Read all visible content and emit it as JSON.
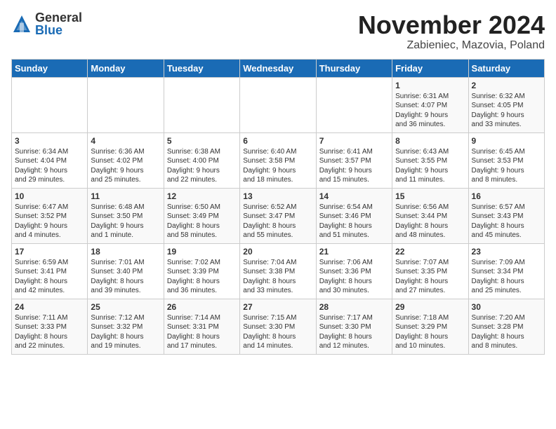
{
  "logo": {
    "general": "General",
    "blue": "Blue"
  },
  "header": {
    "month": "November 2024",
    "location": "Zabieniec, Mazovia, Poland"
  },
  "weekdays": [
    "Sunday",
    "Monday",
    "Tuesday",
    "Wednesday",
    "Thursday",
    "Friday",
    "Saturday"
  ],
  "weeks": [
    [
      {
        "day": "",
        "info": ""
      },
      {
        "day": "",
        "info": ""
      },
      {
        "day": "",
        "info": ""
      },
      {
        "day": "",
        "info": ""
      },
      {
        "day": "",
        "info": ""
      },
      {
        "day": "1",
        "info": "Sunrise: 6:31 AM\nSunset: 4:07 PM\nDaylight: 9 hours\nand 36 minutes."
      },
      {
        "day": "2",
        "info": "Sunrise: 6:32 AM\nSunset: 4:05 PM\nDaylight: 9 hours\nand 33 minutes."
      }
    ],
    [
      {
        "day": "3",
        "info": "Sunrise: 6:34 AM\nSunset: 4:04 PM\nDaylight: 9 hours\nand 29 minutes."
      },
      {
        "day": "4",
        "info": "Sunrise: 6:36 AM\nSunset: 4:02 PM\nDaylight: 9 hours\nand 25 minutes."
      },
      {
        "day": "5",
        "info": "Sunrise: 6:38 AM\nSunset: 4:00 PM\nDaylight: 9 hours\nand 22 minutes."
      },
      {
        "day": "6",
        "info": "Sunrise: 6:40 AM\nSunset: 3:58 PM\nDaylight: 9 hours\nand 18 minutes."
      },
      {
        "day": "7",
        "info": "Sunrise: 6:41 AM\nSunset: 3:57 PM\nDaylight: 9 hours\nand 15 minutes."
      },
      {
        "day": "8",
        "info": "Sunrise: 6:43 AM\nSunset: 3:55 PM\nDaylight: 9 hours\nand 11 minutes."
      },
      {
        "day": "9",
        "info": "Sunrise: 6:45 AM\nSunset: 3:53 PM\nDaylight: 9 hours\nand 8 minutes."
      }
    ],
    [
      {
        "day": "10",
        "info": "Sunrise: 6:47 AM\nSunset: 3:52 PM\nDaylight: 9 hours\nand 4 minutes."
      },
      {
        "day": "11",
        "info": "Sunrise: 6:48 AM\nSunset: 3:50 PM\nDaylight: 9 hours\nand 1 minute."
      },
      {
        "day": "12",
        "info": "Sunrise: 6:50 AM\nSunset: 3:49 PM\nDaylight: 8 hours\nand 58 minutes."
      },
      {
        "day": "13",
        "info": "Sunrise: 6:52 AM\nSunset: 3:47 PM\nDaylight: 8 hours\nand 55 minutes."
      },
      {
        "day": "14",
        "info": "Sunrise: 6:54 AM\nSunset: 3:46 PM\nDaylight: 8 hours\nand 51 minutes."
      },
      {
        "day": "15",
        "info": "Sunrise: 6:56 AM\nSunset: 3:44 PM\nDaylight: 8 hours\nand 48 minutes."
      },
      {
        "day": "16",
        "info": "Sunrise: 6:57 AM\nSunset: 3:43 PM\nDaylight: 8 hours\nand 45 minutes."
      }
    ],
    [
      {
        "day": "17",
        "info": "Sunrise: 6:59 AM\nSunset: 3:41 PM\nDaylight: 8 hours\nand 42 minutes."
      },
      {
        "day": "18",
        "info": "Sunrise: 7:01 AM\nSunset: 3:40 PM\nDaylight: 8 hours\nand 39 minutes."
      },
      {
        "day": "19",
        "info": "Sunrise: 7:02 AM\nSunset: 3:39 PM\nDaylight: 8 hours\nand 36 minutes."
      },
      {
        "day": "20",
        "info": "Sunrise: 7:04 AM\nSunset: 3:38 PM\nDaylight: 8 hours\nand 33 minutes."
      },
      {
        "day": "21",
        "info": "Sunrise: 7:06 AM\nSunset: 3:36 PM\nDaylight: 8 hours\nand 30 minutes."
      },
      {
        "day": "22",
        "info": "Sunrise: 7:07 AM\nSunset: 3:35 PM\nDaylight: 8 hours\nand 27 minutes."
      },
      {
        "day": "23",
        "info": "Sunrise: 7:09 AM\nSunset: 3:34 PM\nDaylight: 8 hours\nand 25 minutes."
      }
    ],
    [
      {
        "day": "24",
        "info": "Sunrise: 7:11 AM\nSunset: 3:33 PM\nDaylight: 8 hours\nand 22 minutes."
      },
      {
        "day": "25",
        "info": "Sunrise: 7:12 AM\nSunset: 3:32 PM\nDaylight: 8 hours\nand 19 minutes."
      },
      {
        "day": "26",
        "info": "Sunrise: 7:14 AM\nSunset: 3:31 PM\nDaylight: 8 hours\nand 17 minutes."
      },
      {
        "day": "27",
        "info": "Sunrise: 7:15 AM\nSunset: 3:30 PM\nDaylight: 8 hours\nand 14 minutes."
      },
      {
        "day": "28",
        "info": "Sunrise: 7:17 AM\nSunset: 3:30 PM\nDaylight: 8 hours\nand 12 minutes."
      },
      {
        "day": "29",
        "info": "Sunrise: 7:18 AM\nSunset: 3:29 PM\nDaylight: 8 hours\nand 10 minutes."
      },
      {
        "day": "30",
        "info": "Sunrise: 7:20 AM\nSunset: 3:28 PM\nDaylight: 8 hours\nand 8 minutes."
      }
    ]
  ]
}
